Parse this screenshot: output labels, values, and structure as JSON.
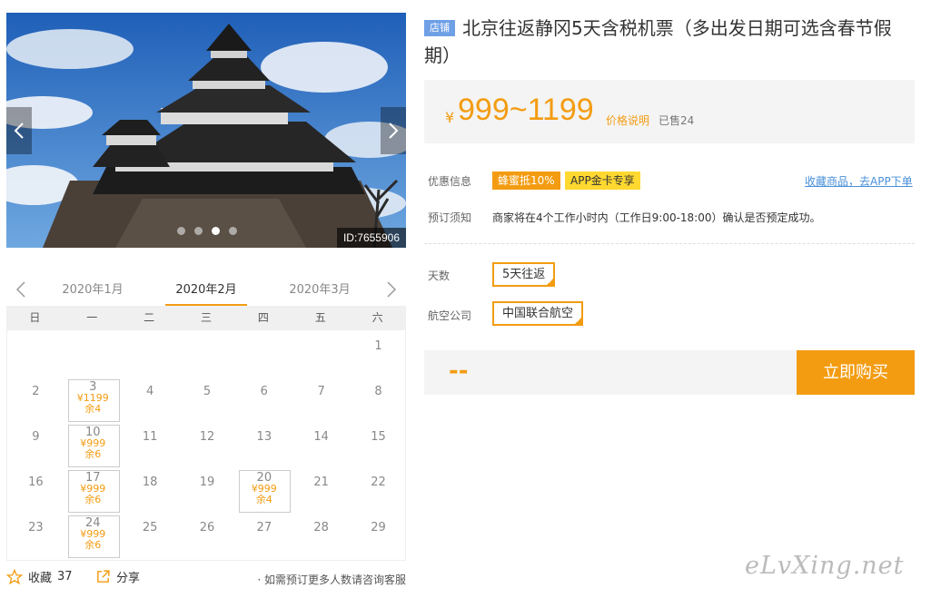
{
  "gallery": {
    "image_id": "ID:7655906",
    "image_subject": "castle-photo",
    "slide_count": 4,
    "active_slide": 3
  },
  "calendar": {
    "months": [
      "2020年1月",
      "2020年2月",
      "2020年3月"
    ],
    "active_month": "2020年2月",
    "weekdays": [
      "日",
      "一",
      "二",
      "三",
      "四",
      "五",
      "六"
    ],
    "weeks": [
      [
        null,
        null,
        null,
        null,
        null,
        null,
        {
          "d": "1"
        }
      ],
      [
        {
          "d": "2"
        },
        {
          "d": "3",
          "price": "¥1199",
          "stock": "余4"
        },
        {
          "d": "4"
        },
        {
          "d": "5"
        },
        {
          "d": "6"
        },
        {
          "d": "7"
        },
        {
          "d": "8"
        }
      ],
      [
        {
          "d": "9"
        },
        {
          "d": "10",
          "price": "¥999",
          "stock": "余6"
        },
        {
          "d": "11"
        },
        {
          "d": "12"
        },
        {
          "d": "13"
        },
        {
          "d": "14"
        },
        {
          "d": "15"
        }
      ],
      [
        {
          "d": "16"
        },
        {
          "d": "17",
          "price": "¥999",
          "stock": "余6"
        },
        {
          "d": "18"
        },
        {
          "d": "19"
        },
        {
          "d": "20",
          "price": "¥999",
          "stock": "余4"
        },
        {
          "d": "21"
        },
        {
          "d": "22"
        }
      ],
      [
        {
          "d": "23"
        },
        {
          "d": "24",
          "price": "¥999",
          "stock": "余6"
        },
        {
          "d": "25"
        },
        {
          "d": "26"
        },
        {
          "d": "27"
        },
        {
          "d": "28"
        },
        {
          "d": "29"
        }
      ]
    ]
  },
  "footer": {
    "favorite_label": "收藏",
    "favorite_count": "37",
    "share_label": "分享",
    "consult_text": "· 如需预订更多人数请咨询客服"
  },
  "product": {
    "badge": "店铺",
    "title": "北京往返静冈5天含税机票（多出发日期可选含春节假期）",
    "currency": "¥",
    "price_range": "999~1199",
    "price_note": "价格说明",
    "sold": "已售24"
  },
  "promo": {
    "label": "优惠信息",
    "tags": [
      "蜂蜜抵10%",
      "APP金卡专享"
    ],
    "collect_link": "收藏商品，去APP下单"
  },
  "booking": {
    "label": "预订须知",
    "notice": "商家将在4个工作小时内（工作日9:00-18:00）确认是否预定成功。"
  },
  "options": {
    "days_label": "天数",
    "days_value": "5天往返",
    "airline_label": "航空公司",
    "airline_value": "中国联合航空"
  },
  "buy": {
    "total": "--",
    "button": "立即购买"
  },
  "colors": {
    "accent": "#f39c12",
    "badge_blue": "#6fa0e6",
    "promo_yellow": "#ffd830",
    "link_blue": "#4a90d9"
  },
  "watermark": "eLvXing.net"
}
